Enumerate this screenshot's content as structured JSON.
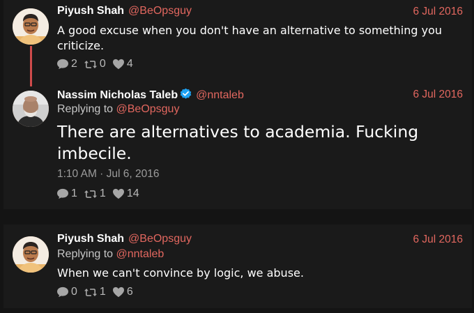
{
  "tweets": [
    {
      "name": "Piyush Shah",
      "handle": "@BeOpsguy",
      "date": "6 Jul 2016",
      "text": "A good excuse when you don't have an alternative to something you criticize.",
      "replies": "2",
      "retweets": "0",
      "likes": "4",
      "avatar": "piyush-avatar"
    },
    {
      "name": "Nassim Nicholas Taleb",
      "handle": "@nntaleb",
      "verified": true,
      "date": "6 Jul 2016",
      "replying_to_label": "Replying to",
      "replying_to": "@BeOpsguy",
      "text_line1": "There are alternatives to academia. Fucking",
      "text_line2": "imbecile.",
      "timestamp": "1:10 AM · Jul 6, 2016",
      "replies": "1",
      "retweets": "1",
      "likes": "14",
      "avatar": "taleb-avatar"
    },
    {
      "name": "Piyush Shah",
      "handle": "@BeOpsguy",
      "date": "6 Jul 2016",
      "replying_to_label": "Replying to",
      "replying_to": "@nntaleb",
      "text": "When we can't convince by logic, we abuse.",
      "replies": "0",
      "retweets": "1",
      "likes": "6",
      "avatar": "piyush-avatar"
    }
  ],
  "icons": {
    "reply": "speech-bubble-icon",
    "retweet": "retweet-icon",
    "like": "heart-icon",
    "verified": "verified-badge-icon"
  },
  "colors": {
    "background": "#141414",
    "card": "#1a1a1a",
    "accent": "#e2675f",
    "thread_line": "#cf4b4b",
    "verified": "#1da1f2",
    "text": "#ffffff",
    "muted": "#9c9c9c"
  }
}
